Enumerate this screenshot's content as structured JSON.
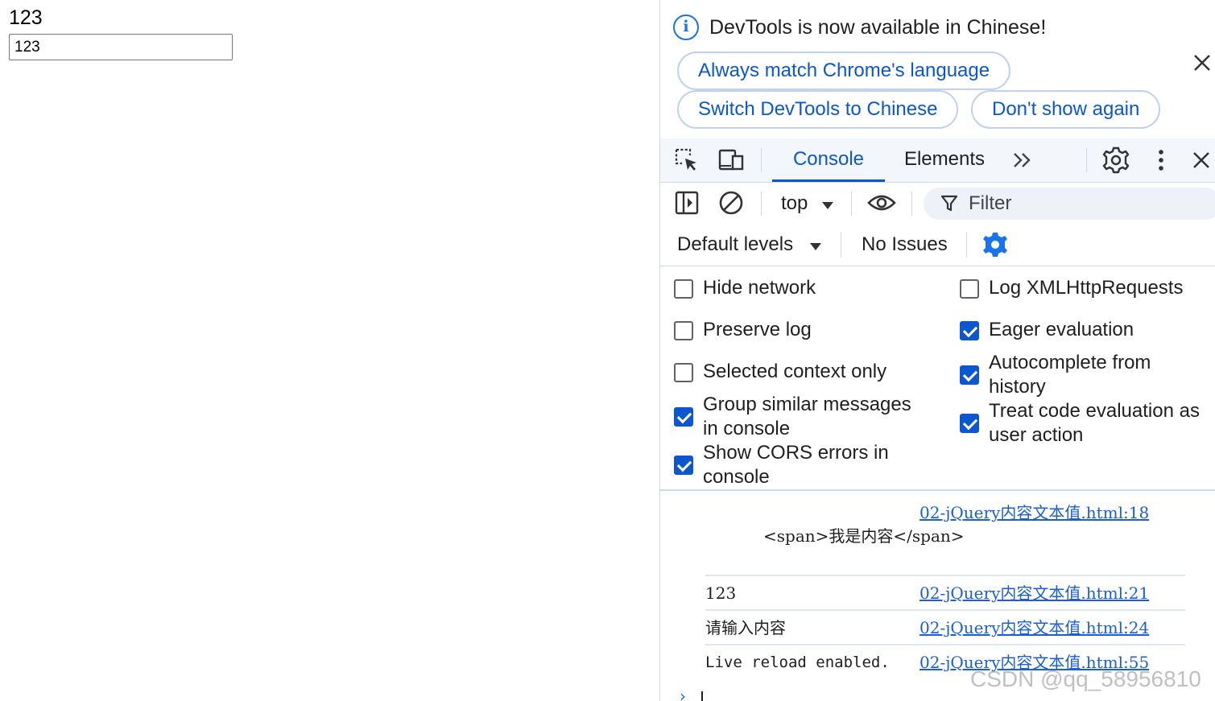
{
  "page": {
    "text": "123",
    "input_value": "123"
  },
  "infobar": {
    "message": "DevTools is now available in Chinese!",
    "always_match": "Always match Chrome's language",
    "switch_chinese": "Switch DevTools to Chinese",
    "dont_show": "Don't show again"
  },
  "tabs": {
    "console": "Console",
    "elements": "Elements"
  },
  "toolbar": {
    "context": "top",
    "filter_placeholder": "Filter",
    "levels": "Default levels",
    "issues": "No Issues"
  },
  "settings": {
    "left": [
      {
        "label": "Hide network",
        "checked": false
      },
      {
        "label": "Preserve log",
        "checked": false
      },
      {
        "label": "Selected context only",
        "checked": false
      },
      {
        "label_line1": "Group similar messages",
        "label_line2": "in console",
        "checked": true
      },
      {
        "label_line1": "Show CORS errors in",
        "label_line2": "console",
        "checked": true
      }
    ],
    "right": [
      {
        "label": "Log XMLHttpRequests",
        "checked": false
      },
      {
        "label": "Eager evaluation",
        "checked": true
      },
      {
        "label_line1": "Autocomplete from",
        "label_line2": "history",
        "checked": true
      },
      {
        "label_line1": "Treat code evaluation as",
        "label_line2": "user action",
        "checked": true
      }
    ]
  },
  "console": {
    "messages": [
      {
        "text": "<span>我是内容</span>",
        "source": "02-jQuery内容文本值.html:18"
      },
      {
        "text": "123",
        "source": "02-jQuery内容文本值.html:21"
      },
      {
        "text": "请输入内容",
        "source": "02-jQuery内容文本值.html:24"
      },
      {
        "text": "Live reload enabled.",
        "source": "02-jQuery内容文本值.html:55"
      }
    ],
    "prompt": "›"
  },
  "watermark": "CSDN @qq_58956810",
  "colors": {
    "accent": "#0b57d0",
    "link": "#1a5fd8",
    "toolbar_bg": "#f3f6fb"
  }
}
